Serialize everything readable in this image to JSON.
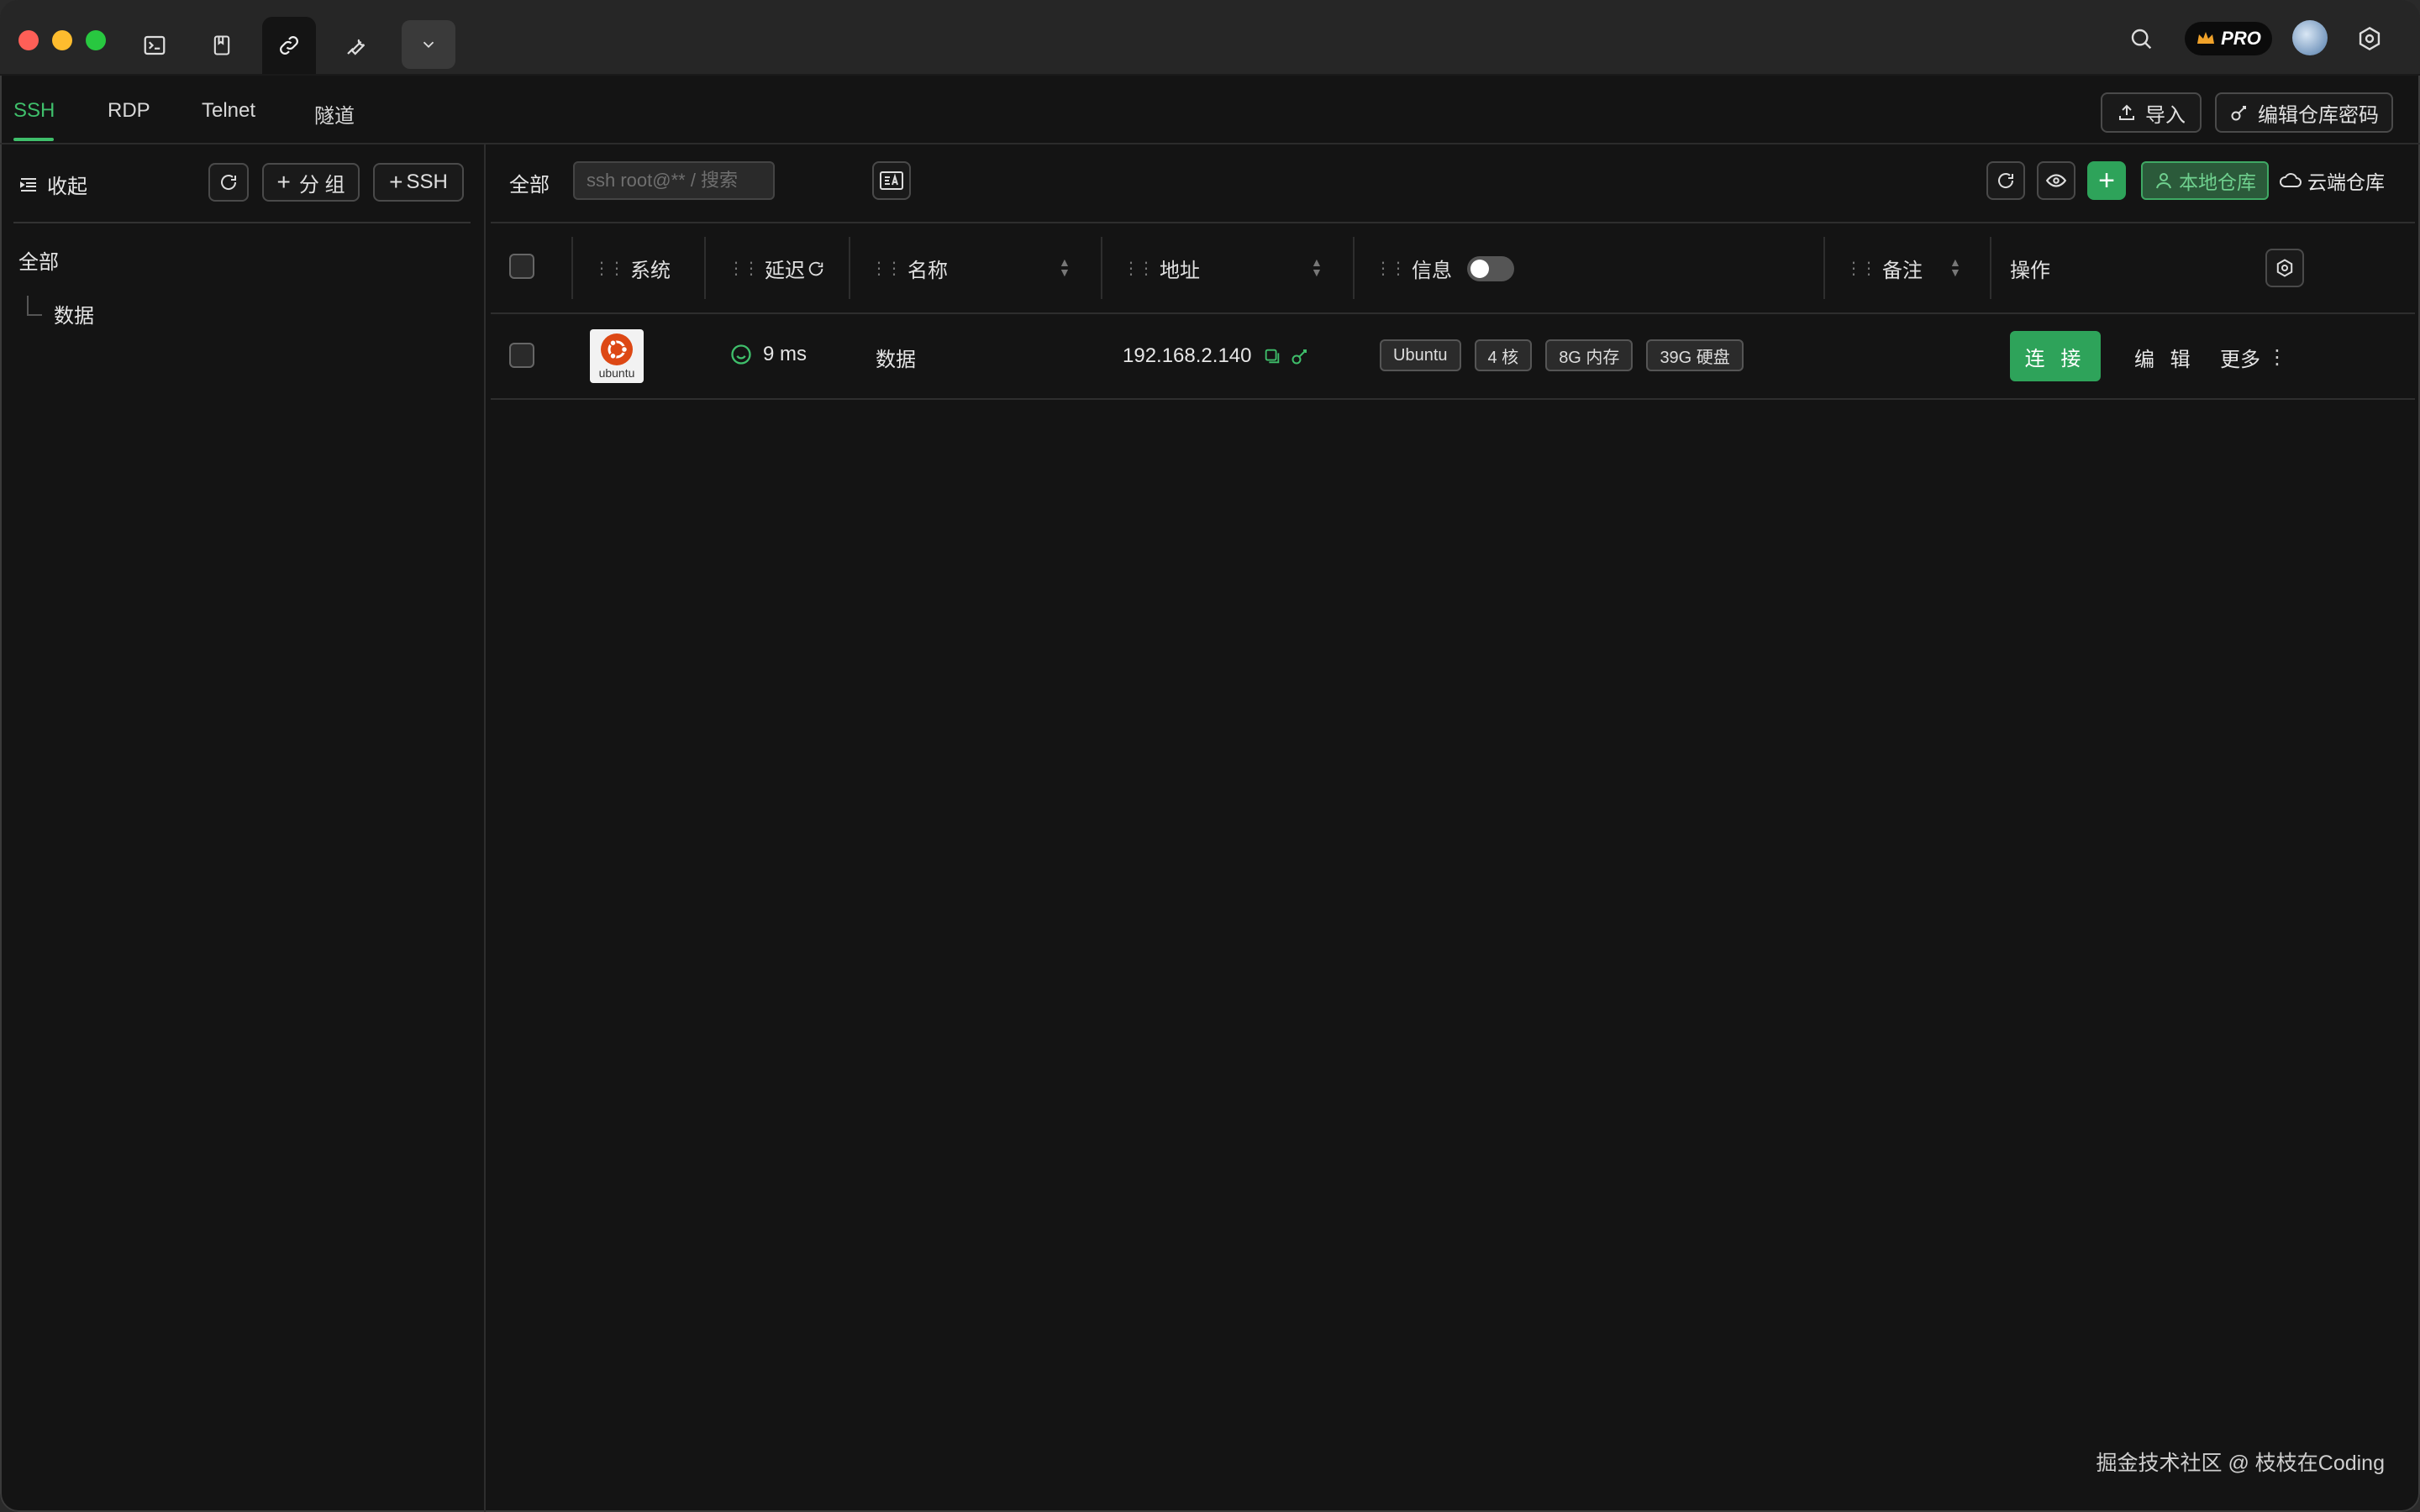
{
  "titlebar": {
    "tabs": [
      {
        "icon": "terminal-icon"
      },
      {
        "icon": "bookmark-icon"
      },
      {
        "icon": "link-icon",
        "active": true
      },
      {
        "icon": "wrench-icon"
      }
    ],
    "pro_label": "PRO"
  },
  "subtabs": [
    "SSH",
    "RDP",
    "Telnet",
    "隧道"
  ],
  "toolbar": {
    "import_label": "导入",
    "edit_vault_password_label": "编辑仓库密码"
  },
  "sidebar": {
    "collapse_label": "收起",
    "add_group_label": "分 组",
    "add_ssh_label": "SSH",
    "tree_root": "全部",
    "tree_children": [
      "数据"
    ]
  },
  "main": {
    "scope_label": "全部",
    "search_placeholder": "ssh root@** / 搜索",
    "local_vault_label": "本地仓库",
    "cloud_vault_label": "云端仓库"
  },
  "table": {
    "headers": {
      "system": "系统",
      "latency": "延迟",
      "name": "名称",
      "address": "地址",
      "info": "信息",
      "note": "备注",
      "actions": "操作"
    },
    "rows": [
      {
        "os": "ubuntu",
        "latency": "9 ms",
        "name": "数据",
        "address": "192.168.2.140",
        "tags": [
          "Ubuntu",
          "4 核",
          "8G 内存",
          "39G 硬盘"
        ],
        "connect_label": "连 接",
        "edit_label": "编 辑",
        "more_label": "更多"
      }
    ]
  },
  "watermark": "掘金技术社区 @ 枝枝在Coding",
  "colors": {
    "accent": "#2ea35a",
    "accent_text": "#3fbf6b",
    "background": "#141414"
  }
}
